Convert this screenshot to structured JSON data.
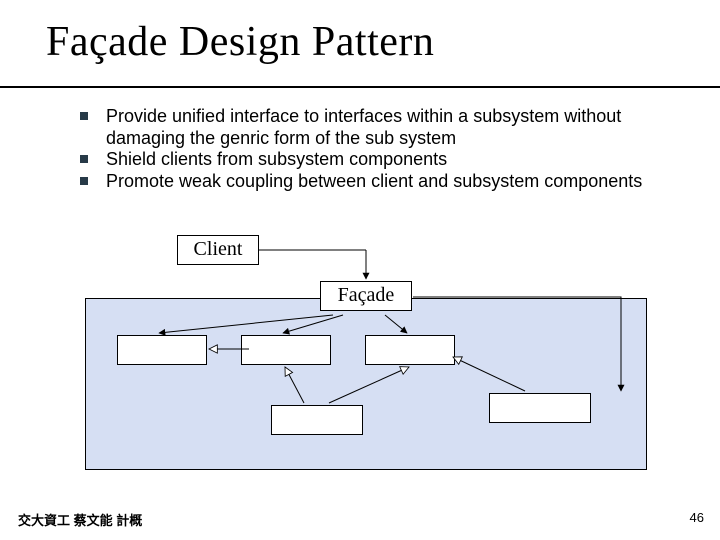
{
  "title": "Façade Design Pattern",
  "bullets": [
    "Provide unified interface to interfaces within a subsystem without damaging the genric form of the sub system",
    "Shield clients from subsystem components",
    "Promote weak coupling between client and subsystem components"
  ],
  "diagram": {
    "client_label": "Client",
    "facade_label": "Façade"
  },
  "footer_left": "交大資工 蔡文能 計概",
  "page_number": "46"
}
